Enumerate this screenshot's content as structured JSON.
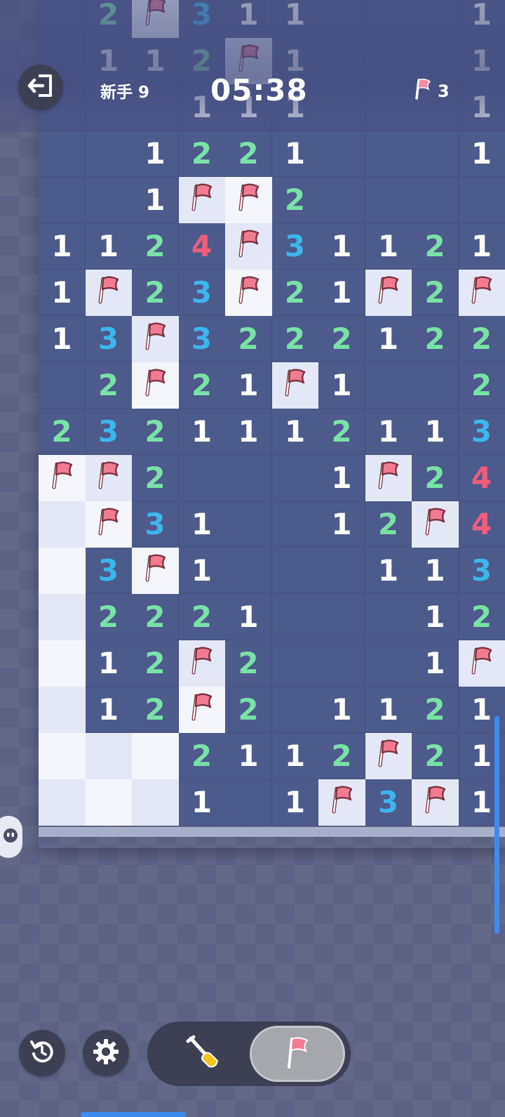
{
  "header": {
    "level_label": "新手 9",
    "timer": "05:38",
    "flags_remaining": "3"
  },
  "colors": {
    "number_1": "#ffffff",
    "number_2": "#79e2a7",
    "number_3": "#3cb6ec",
    "number_4": "#ef5d7c",
    "revealed_cell": "#4d5a8c",
    "flag": "#f27b93"
  },
  "board": {
    "columns": 10,
    "cell_legend": "digits = revealed numbers, '.' = revealed empty, 'F' = flagged, 'H' = hidden",
    "rows": [
      ". 2 F 3 1 1 . . . 1",
      ". 1 1 2 F 1 . . . 1",
      ". . . 1 1 1 . . . 1",
      ". . 1 2 2 1 . . . 1",
      ". . 1 F F 2 . . . .",
      "1 1 2 4 F 3 1 1 2 1",
      "1 F 2 3 F 2 1 F 2 F",
      "1 3 F 3 2 2 2 1 2 2",
      ". 2 F 2 1 F 1 . . 2",
      "2 3 2 1 1 1 2 1 1 3",
      "F F 2 . . . 1 F 2 4",
      "H F 3 1 . . 1 2 F 4",
      "H 3 F 1 . . . 1 1 3",
      "H 2 2 2 1 . . . 1 2",
      "H 1 2 F 2 . . . 1 F",
      "H 1 2 F 2 . 1 1 2 1",
      "H H H 2 1 1 2 F 2 1",
      "H H H 1 . 1 F 3 F 1"
    ]
  },
  "controls": {
    "exit_icon": "exit-icon",
    "restart_icon": "restart-icon",
    "settings_icon": "gear-icon",
    "dig_mode_icon": "shovel-icon",
    "flag_mode_icon": "flag-icon",
    "active_mode": "flag"
  }
}
